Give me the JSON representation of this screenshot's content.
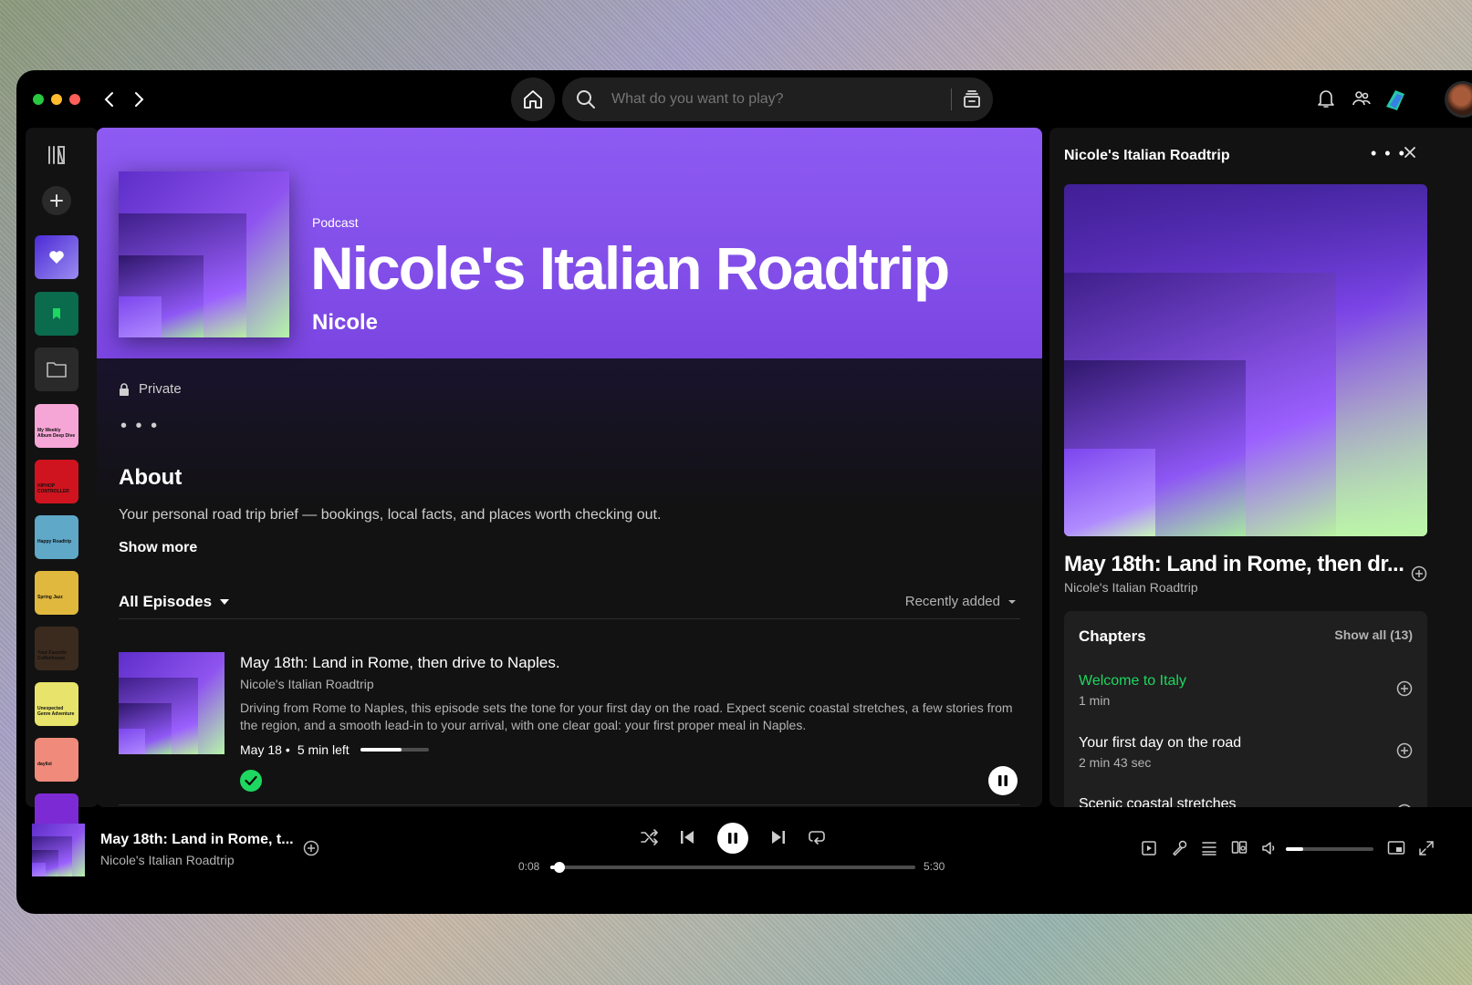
{
  "colors": {
    "accent_green": "#1ed760",
    "hero_purple": "#8d5bf2",
    "panel": "#121212",
    "traffic_lights": [
      "#28c840",
      "#febc2e",
      "#ff5f57"
    ]
  },
  "topbar": {
    "search_placeholder": "What do you want to play?",
    "icons": [
      "back-icon",
      "forward-icon",
      "home-icon",
      "search-icon",
      "browse-icon",
      "bell-icon",
      "friends-icon",
      "app-logo-icon",
      "avatar"
    ]
  },
  "rail": {
    "icons": [
      "library-icon",
      "plus-icon",
      "liked-heart-icon",
      "bookmark-icon",
      "folder-icon"
    ],
    "tiles": [
      {
        "label": "My Weekly Album Deep Dive",
        "color": "#f6a6d6"
      },
      {
        "label": "HIPHOP CONTROLLER",
        "color": "#d0141f"
      },
      {
        "label": "Happy Roadtrip",
        "color": "#5fa8c8"
      },
      {
        "label": "Spring Jazz",
        "color": "#e0b83e"
      },
      {
        "label": "Your Favorite Coffeehouse",
        "color": "#3b2a1e"
      },
      {
        "label": "Unexpected Genre Adventure",
        "color": "#e8e36a"
      },
      {
        "label": "daylist",
        "color": "#f08a7b"
      },
      {
        "label": "",
        "color": "#7c2bd4"
      }
    ]
  },
  "main": {
    "type_label": "Podcast",
    "title": "Nicole's Italian Roadtrip",
    "author": "Nicole",
    "privacy": "Private",
    "more": "• • •",
    "about_heading": "About",
    "about_text": "Your personal road trip brief — bookings, local facts, and places worth checking out.",
    "show_more": "Show more",
    "filter_label": "All Episodes",
    "sort_label": "Recently added",
    "episodes": [
      {
        "title": "May 18th: Land in Rome, then drive to Naples.",
        "show": "Nicole's Italian Roadtrip",
        "description": "Driving from Rome to Naples, this episode sets the tone for your first day on the road. Expect scenic coastal stretches, a few stories from the region, and a smooth lead-in to your arrival, with one clear goal: your first proper meal in Naples.",
        "date": "May 18",
        "separator": "•",
        "remaining": "5 min left",
        "progress": 0.6
      }
    ]
  },
  "right_panel": {
    "title": "Nicole's Italian Roadtrip",
    "more": "• • •",
    "episode_title": "May 18th: Land in Rome, then dr...",
    "episode_show": "Nicole's Italian Roadtrip",
    "chapters_heading": "Chapters",
    "show_all": "Show all (13)",
    "chapters": [
      {
        "name": "Welcome to Italy",
        "duration": "1 min",
        "active": true
      },
      {
        "name": "Your first day on the road",
        "duration": "2 min 43 sec",
        "active": false
      },
      {
        "name": "Scenic coastal stretches",
        "duration": "",
        "active": false
      }
    ]
  },
  "player": {
    "title": "May 18th: Land in Rome, t...",
    "show": "Nicole's Italian Roadtrip",
    "elapsed": "0:08",
    "duration": "5:30",
    "progress": 0.024,
    "volume": 0.2
  }
}
